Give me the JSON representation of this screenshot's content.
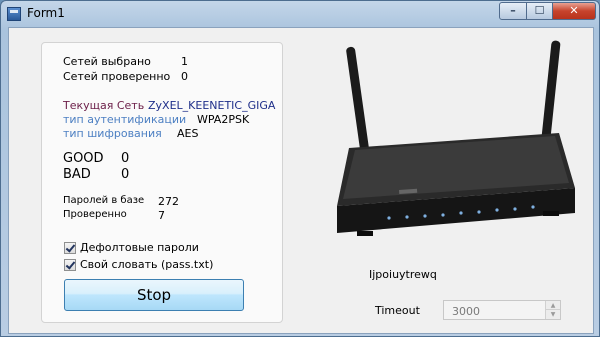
{
  "window": {
    "title": "Form1",
    "minimize_glyph": "–",
    "maximize_glyph": "☐",
    "close_glyph": "✕"
  },
  "stats": {
    "networks_selected_label": "Сетей выбрано",
    "networks_selected_value": "1",
    "networks_checked_label": "Сетей проверенно",
    "networks_checked_value": "0"
  },
  "network": {
    "current_label": "Текущая Сеть",
    "current_value": "ZyXEL_KEENETIC_GIGA",
    "auth_label": "тип аутентификации",
    "auth_value": "WPA2PSK",
    "cipher_label": "тип шифрования",
    "cipher_value": "AES"
  },
  "results": {
    "good_label": "GOOD",
    "good_value": "0",
    "bad_label": "BAD",
    "bad_value": "0"
  },
  "passwords": {
    "in_base_label": "Паролей в базе",
    "in_base_value": "272",
    "checked_label": "Проверенно",
    "checked_value": "7"
  },
  "options": {
    "default_passwords_label": "Дефолтовые пароли",
    "default_passwords_checked": true,
    "own_dictionary_label": "Свой словать (pass.txt)",
    "own_dictionary_checked": true
  },
  "stop_button_label": "Stop",
  "status_text": "Ijpoiuytrewq",
  "timeout": {
    "label": "Timeout",
    "value": "3000"
  },
  "router_image": {
    "icon": "wifi-router-image"
  }
}
